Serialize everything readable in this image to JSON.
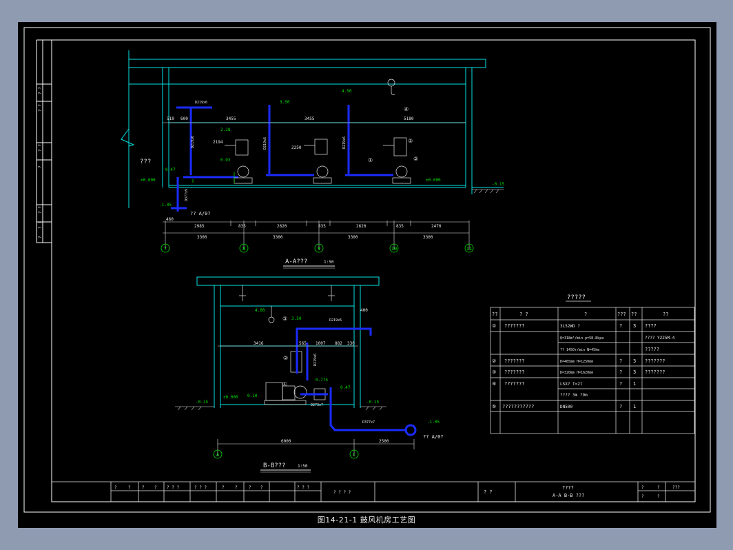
{
  "caption": "图14-21-1 鼓风机房工艺图",
  "colors": {
    "background": "#000000",
    "frame": "#ffffff",
    "structure": "#00e5e5",
    "dimension": "#e8e8e8",
    "pipe": "#1a2cff",
    "level": "#00e000",
    "label": "#e8e8e8"
  },
  "section_aa": {
    "title": "A-A???",
    "scale": "1:50",
    "room_label": "???",
    "axis_labels": [
      "7",
      "8",
      "9",
      "10",
      "11"
    ],
    "dims_top": [
      "510",
      "600",
      "3455",
      "3455",
      "5180"
    ],
    "dims_mid": [
      "2194",
      "2250"
    ],
    "dims_row1": [
      "460",
      "2985",
      "835",
      "2620",
      "835",
      "2620",
      "835",
      "2470"
    ],
    "dims_row2": [
      "3300",
      "3300",
      "3300",
      "3300"
    ],
    "levels": [
      "4.50",
      "3.50",
      "2.18",
      "0.93",
      "0.47",
      "±0.000",
      "±0.000",
      "-0.15",
      "-1.05"
    ],
    "pipe_labels": [
      "D219x6",
      "D219x6",
      "D219x6",
      "D219x6",
      "D377x9"
    ],
    "outlet_label": "?? A/0?",
    "markers": [
      "①",
      "②",
      "③",
      "④"
    ]
  },
  "section_bb": {
    "title": "B-B???",
    "scale": "1:50",
    "axis_labels": [
      "A",
      "C"
    ],
    "dims": [
      "3416",
      "565",
      "1007",
      "882",
      "330",
      "400",
      "6000",
      "2500"
    ],
    "levels": [
      "4.60",
      "3.50",
      "0.775",
      "0.47",
      "±0.000",
      "0.10",
      "-0.15",
      "-0.15",
      "-1.05"
    ],
    "pipe_labels": [
      "D219x6",
      "D219x6",
      "D273x7",
      "D377x7"
    ],
    "outlet_label": "?? A/0?",
    "markers": [
      "①",
      "②",
      "③"
    ]
  },
  "material_table": {
    "title": "?????",
    "headers": [
      "??",
      "?  ?",
      "?",
      "???",
      "??",
      "??"
    ],
    "rows": [
      {
        "no": "①",
        "name": "???????",
        "spec": "3L52WD ?",
        "unit": "?",
        "qty": "3",
        "note": "????"
      },
      {
        "no": "",
        "name": "",
        "spec": "Q=318m³/min  p=58.8kpa",
        "unit": "",
        "qty": "",
        "note": "???? Y225M-4"
      },
      {
        "no": "",
        "name": "",
        "spec": "?? 1450r/min  N=45kw",
        "unit": "",
        "qty": "",
        "note": "?????"
      },
      {
        "no": "②",
        "name": "???????",
        "spec": "D=465mm  H=1250mm",
        "unit": "?",
        "qty": "3",
        "note": "???????"
      },
      {
        "no": "③",
        "name": "???????",
        "spec": "D=320mm  H=1620mm",
        "unit": "?",
        "qty": "3",
        "note": "???????"
      },
      {
        "no": "④",
        "name": "???????",
        "spec": "LSX?  T=2t",
        "unit": "?",
        "qty": "1",
        "note": ""
      },
      {
        "no": "",
        "name": "",
        "spec": "???? 3m   ?9m",
        "unit": "",
        "qty": "",
        "note": ""
      },
      {
        "no": "⑤",
        "name": "???????????",
        "spec": "DN500",
        "unit": "?",
        "qty": "1",
        "note": ""
      },
      {
        "no": "",
        "name": "",
        "spec": "",
        "unit": "",
        "qty": "",
        "note": ""
      }
    ]
  },
  "title_block": {
    "cells": [
      "?",
      "?",
      "?",
      "?",
      "? ? ?",
      "? ? ?",
      "?",
      "?",
      "?",
      "?",
      "? ? ?"
    ],
    "stamp": "? ? ? ?",
    "designer": "?  ?",
    "drawing_name_1": "????",
    "drawing_name_2": "A-A  B-B ???",
    "right_top": [
      "?",
      "?",
      "???"
    ],
    "right_bottom": [
      "?",
      "?"
    ]
  },
  "left_strip": [
    "? ?",
    "? ?",
    "? ?",
    "?",
    "? ?",
    "? ?",
    "?"
  ]
}
